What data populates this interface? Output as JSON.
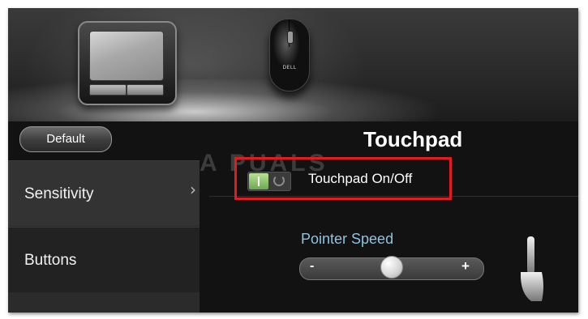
{
  "window": {
    "default_button_label": "Default",
    "panel_title": "Touchpad"
  },
  "devices": {
    "mouse_brand": "DELL",
    "touchpad_icon": "touchpad-device-icon",
    "mouse_icon": "mouse-device-icon"
  },
  "sidebar": {
    "items": [
      {
        "label": "Sensitivity",
        "selected": true
      },
      {
        "label": "Buttons",
        "selected": false
      }
    ],
    "active_arrow": "›"
  },
  "touchpad_toggle": {
    "label": "Touchpad On/Off",
    "state": "on",
    "highlight_color": "#e21b23"
  },
  "pointer_speed": {
    "label": "Pointer Speed",
    "minus": "-",
    "plus": "+",
    "value_fraction": 0.5,
    "label_color": "#8fc3e0"
  },
  "watermark": "A PUALS"
}
